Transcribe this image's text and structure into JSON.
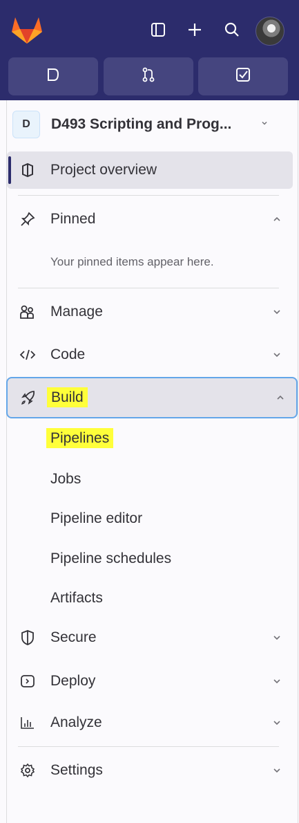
{
  "colors": {
    "topbar": "#2c2c6c",
    "button": "#45457f",
    "highlight": "#ffff3a",
    "focus_ring": "#63a6e9"
  },
  "topbar": {
    "logo": "gitlab-tanuki-logo",
    "icons": [
      "sidebar-toggle-icon",
      "plus-icon",
      "search-icon",
      "user-avatar"
    ],
    "action_buttons": [
      "issues-icon",
      "merge-requests-icon",
      "todos-icon"
    ]
  },
  "project": {
    "avatar_letter": "D",
    "name": "D493 Scripting and Prog..."
  },
  "nav": {
    "overview": "Project overview",
    "pinned": "Pinned",
    "pinned_hint": "Your pinned items appear here.",
    "manage": "Manage",
    "code": "Code",
    "build": "Build",
    "build_items": [
      "Pipelines",
      "Jobs",
      "Pipeline editor",
      "Pipeline schedules",
      "Artifacts"
    ],
    "secure": "Secure",
    "deploy": "Deploy",
    "analyze": "Analyze",
    "settings": "Settings"
  }
}
